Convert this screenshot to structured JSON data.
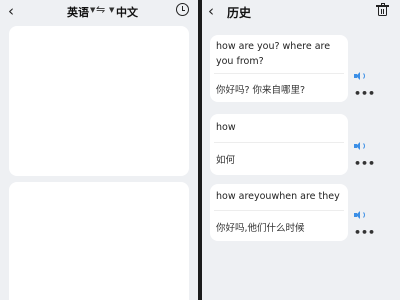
{
  "translator": {
    "source_lang": "英语",
    "swap_icon": "swap-icon",
    "target_lang": "中文"
  },
  "history": {
    "title": "历史",
    "items": [
      {
        "source": "how are you?  where are you from?",
        "translation": "你好吗?  你来自哪里?"
      },
      {
        "source": "how",
        "translation": "如何"
      },
      {
        "source": "how areyouwhen are they",
        "translation": "你好吗,他们什么时候"
      }
    ]
  },
  "colors": {
    "speaker": "#3a8ee6",
    "background": "#eef0f3",
    "card": "#ffffff"
  }
}
